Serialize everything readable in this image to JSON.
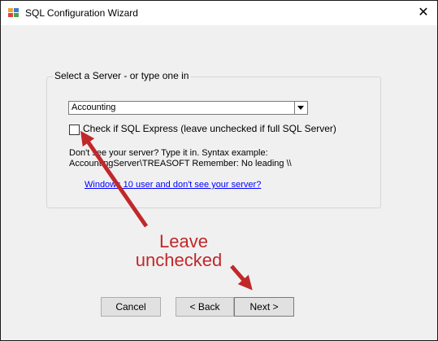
{
  "window": {
    "title": "SQL Configuration Wizard",
    "close_glyph": "✕"
  },
  "group": {
    "label": "Select a Server - or type one in"
  },
  "server_select": {
    "value": "Accounting"
  },
  "express_checkbox": {
    "label": "Check if SQL Express (leave unchecked if full SQL Server)",
    "checked": false
  },
  "hint": {
    "line1": "Don't see your server?  Type it in.  Syntax example:",
    "line2": "AccountingServer\\TREASOFT     Remember: No leading \\\\"
  },
  "link": {
    "text": "Windows 10 user and don't see your server?"
  },
  "buttons": {
    "cancel": "Cancel",
    "back": "< Back",
    "next": "Next >"
  },
  "annotation": {
    "line1": "Leave",
    "line2": "unchecked",
    "color": "#c0282a"
  },
  "icons": {
    "app": "app-icon",
    "close": "close-icon",
    "dropdown": "chevron-down-icon"
  }
}
